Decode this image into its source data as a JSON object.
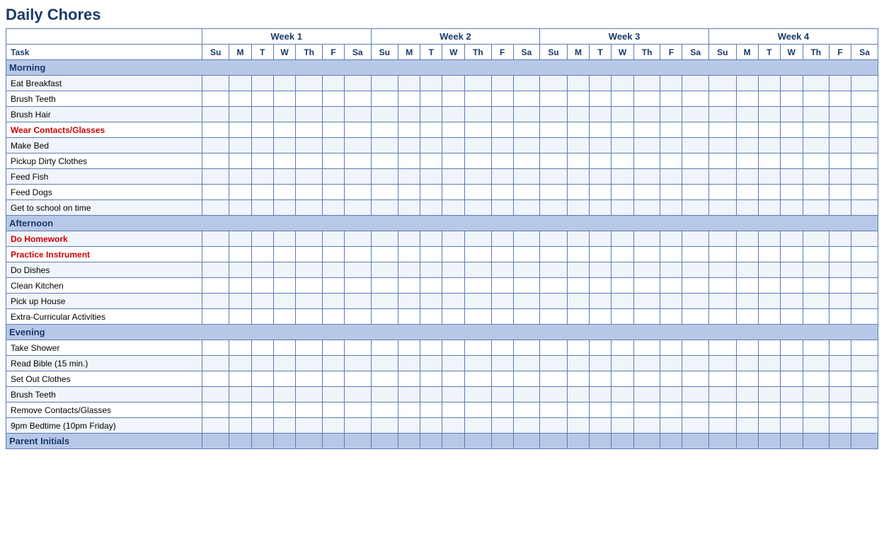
{
  "title": "Daily Chores",
  "weeks": [
    "Week 1",
    "Week 2",
    "Week 3",
    "Week 4"
  ],
  "days": [
    "Su",
    "M",
    "T",
    "W",
    "Th",
    "F",
    "Sa"
  ],
  "task_header": "Task",
  "sections": [
    {
      "name": "Morning",
      "tasks": [
        {
          "label": "Eat Breakfast",
          "red": false
        },
        {
          "label": "Brush Teeth",
          "red": false
        },
        {
          "label": "Brush Hair",
          "red": false
        },
        {
          "label": "Wear Contacts/Glasses",
          "red": true
        },
        {
          "label": "Make Bed",
          "red": false
        },
        {
          "label": "Pickup Dirty Clothes",
          "red": false
        },
        {
          "label": "Feed Fish",
          "red": false
        },
        {
          "label": "Feed Dogs",
          "red": false
        },
        {
          "label": "Get to school on time",
          "red": false
        }
      ]
    },
    {
      "name": "Afternoon",
      "tasks": [
        {
          "label": "Do Homework",
          "red": true
        },
        {
          "label": "Practice Instrument",
          "red": true
        },
        {
          "label": "Do Dishes",
          "red": false
        },
        {
          "label": "Clean Kitchen",
          "red": false
        },
        {
          "label": "Pick up House",
          "red": false
        },
        {
          "label": "Extra-Curricular Activities",
          "red": false
        }
      ]
    },
    {
      "name": "Evening",
      "tasks": [
        {
          "label": "Take Shower",
          "red": false
        },
        {
          "label": "Read Bible (15 min.)",
          "red": false
        },
        {
          "label": "Set Out Clothes",
          "red": false
        },
        {
          "label": "Brush Teeth",
          "red": false
        },
        {
          "label": "Remove Contacts/Glasses",
          "red": false
        },
        {
          "label": "9pm Bedtime (10pm Friday)",
          "red": false
        }
      ]
    }
  ],
  "parent_initials": "Parent Initials"
}
